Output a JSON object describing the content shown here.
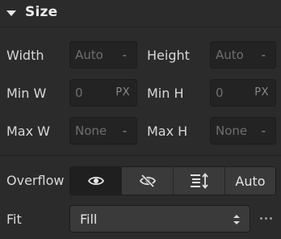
{
  "section": {
    "title": "Size",
    "icon": "caret-down-icon"
  },
  "rows": {
    "width": {
      "label": "Width",
      "value": "Auto",
      "suffix": "-"
    },
    "height": {
      "label": "Height",
      "value": "Auto",
      "suffix": "-"
    },
    "min_w": {
      "label": "Min W",
      "value": "0",
      "suffix": "PX"
    },
    "min_h": {
      "label": "Min H",
      "value": "0",
      "suffix": "PX"
    },
    "max_w": {
      "label": "Max W",
      "value": "None",
      "suffix": "-"
    },
    "max_h": {
      "label": "Max H",
      "value": "None",
      "suffix": "-"
    }
  },
  "overflow": {
    "label": "Overflow",
    "options": [
      {
        "icon": "eye-icon",
        "selected": true
      },
      {
        "icon": "eye-slash-icon",
        "selected": false
      },
      {
        "icon": "scroll-icon",
        "selected": false
      },
      {
        "label": "Auto",
        "selected": false
      }
    ]
  },
  "fit": {
    "label": "Fit",
    "value": "Fill",
    "more_icon": "more-horizontal-icon"
  },
  "colors": {
    "background": "#2b2b2b",
    "field": "#232323",
    "active_segment": "#1f1f1f",
    "segment": "#3a3a3a"
  }
}
